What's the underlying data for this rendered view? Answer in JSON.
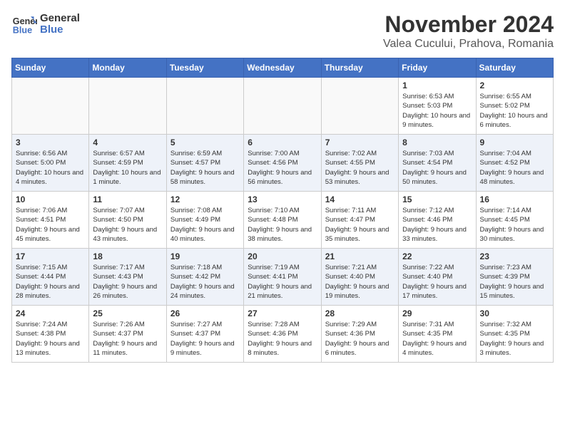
{
  "logo": {
    "line1": "General",
    "line2": "Blue"
  },
  "title": "November 2024",
  "subtitle": "Valea Cucului, Prahova, Romania",
  "days_of_week": [
    "Sunday",
    "Monday",
    "Tuesday",
    "Wednesday",
    "Thursday",
    "Friday",
    "Saturday"
  ],
  "weeks": [
    [
      {
        "day": "",
        "info": ""
      },
      {
        "day": "",
        "info": ""
      },
      {
        "day": "",
        "info": ""
      },
      {
        "day": "",
        "info": ""
      },
      {
        "day": "",
        "info": ""
      },
      {
        "day": "1",
        "info": "Sunrise: 6:53 AM\nSunset: 5:03 PM\nDaylight: 10 hours and 9 minutes."
      },
      {
        "day": "2",
        "info": "Sunrise: 6:55 AM\nSunset: 5:02 PM\nDaylight: 10 hours and 6 minutes."
      }
    ],
    [
      {
        "day": "3",
        "info": "Sunrise: 6:56 AM\nSunset: 5:00 PM\nDaylight: 10 hours and 4 minutes."
      },
      {
        "day": "4",
        "info": "Sunrise: 6:57 AM\nSunset: 4:59 PM\nDaylight: 10 hours and 1 minute."
      },
      {
        "day": "5",
        "info": "Sunrise: 6:59 AM\nSunset: 4:57 PM\nDaylight: 9 hours and 58 minutes."
      },
      {
        "day": "6",
        "info": "Sunrise: 7:00 AM\nSunset: 4:56 PM\nDaylight: 9 hours and 56 minutes."
      },
      {
        "day": "7",
        "info": "Sunrise: 7:02 AM\nSunset: 4:55 PM\nDaylight: 9 hours and 53 minutes."
      },
      {
        "day": "8",
        "info": "Sunrise: 7:03 AM\nSunset: 4:54 PM\nDaylight: 9 hours and 50 minutes."
      },
      {
        "day": "9",
        "info": "Sunrise: 7:04 AM\nSunset: 4:52 PM\nDaylight: 9 hours and 48 minutes."
      }
    ],
    [
      {
        "day": "10",
        "info": "Sunrise: 7:06 AM\nSunset: 4:51 PM\nDaylight: 9 hours and 45 minutes."
      },
      {
        "day": "11",
        "info": "Sunrise: 7:07 AM\nSunset: 4:50 PM\nDaylight: 9 hours and 43 minutes."
      },
      {
        "day": "12",
        "info": "Sunrise: 7:08 AM\nSunset: 4:49 PM\nDaylight: 9 hours and 40 minutes."
      },
      {
        "day": "13",
        "info": "Sunrise: 7:10 AM\nSunset: 4:48 PM\nDaylight: 9 hours and 38 minutes."
      },
      {
        "day": "14",
        "info": "Sunrise: 7:11 AM\nSunset: 4:47 PM\nDaylight: 9 hours and 35 minutes."
      },
      {
        "day": "15",
        "info": "Sunrise: 7:12 AM\nSunset: 4:46 PM\nDaylight: 9 hours and 33 minutes."
      },
      {
        "day": "16",
        "info": "Sunrise: 7:14 AM\nSunset: 4:45 PM\nDaylight: 9 hours and 30 minutes."
      }
    ],
    [
      {
        "day": "17",
        "info": "Sunrise: 7:15 AM\nSunset: 4:44 PM\nDaylight: 9 hours and 28 minutes."
      },
      {
        "day": "18",
        "info": "Sunrise: 7:17 AM\nSunset: 4:43 PM\nDaylight: 9 hours and 26 minutes."
      },
      {
        "day": "19",
        "info": "Sunrise: 7:18 AM\nSunset: 4:42 PM\nDaylight: 9 hours and 24 minutes."
      },
      {
        "day": "20",
        "info": "Sunrise: 7:19 AM\nSunset: 4:41 PM\nDaylight: 9 hours and 21 minutes."
      },
      {
        "day": "21",
        "info": "Sunrise: 7:21 AM\nSunset: 4:40 PM\nDaylight: 9 hours and 19 minutes."
      },
      {
        "day": "22",
        "info": "Sunrise: 7:22 AM\nSunset: 4:40 PM\nDaylight: 9 hours and 17 minutes."
      },
      {
        "day": "23",
        "info": "Sunrise: 7:23 AM\nSunset: 4:39 PM\nDaylight: 9 hours and 15 minutes."
      }
    ],
    [
      {
        "day": "24",
        "info": "Sunrise: 7:24 AM\nSunset: 4:38 PM\nDaylight: 9 hours and 13 minutes."
      },
      {
        "day": "25",
        "info": "Sunrise: 7:26 AM\nSunset: 4:37 PM\nDaylight: 9 hours and 11 minutes."
      },
      {
        "day": "26",
        "info": "Sunrise: 7:27 AM\nSunset: 4:37 PM\nDaylight: 9 hours and 9 minutes."
      },
      {
        "day": "27",
        "info": "Sunrise: 7:28 AM\nSunset: 4:36 PM\nDaylight: 9 hours and 8 minutes."
      },
      {
        "day": "28",
        "info": "Sunrise: 7:29 AM\nSunset: 4:36 PM\nDaylight: 9 hours and 6 minutes."
      },
      {
        "day": "29",
        "info": "Sunrise: 7:31 AM\nSunset: 4:35 PM\nDaylight: 9 hours and 4 minutes."
      },
      {
        "day": "30",
        "info": "Sunrise: 7:32 AM\nSunset: 4:35 PM\nDaylight: 9 hours and 3 minutes."
      }
    ]
  ]
}
